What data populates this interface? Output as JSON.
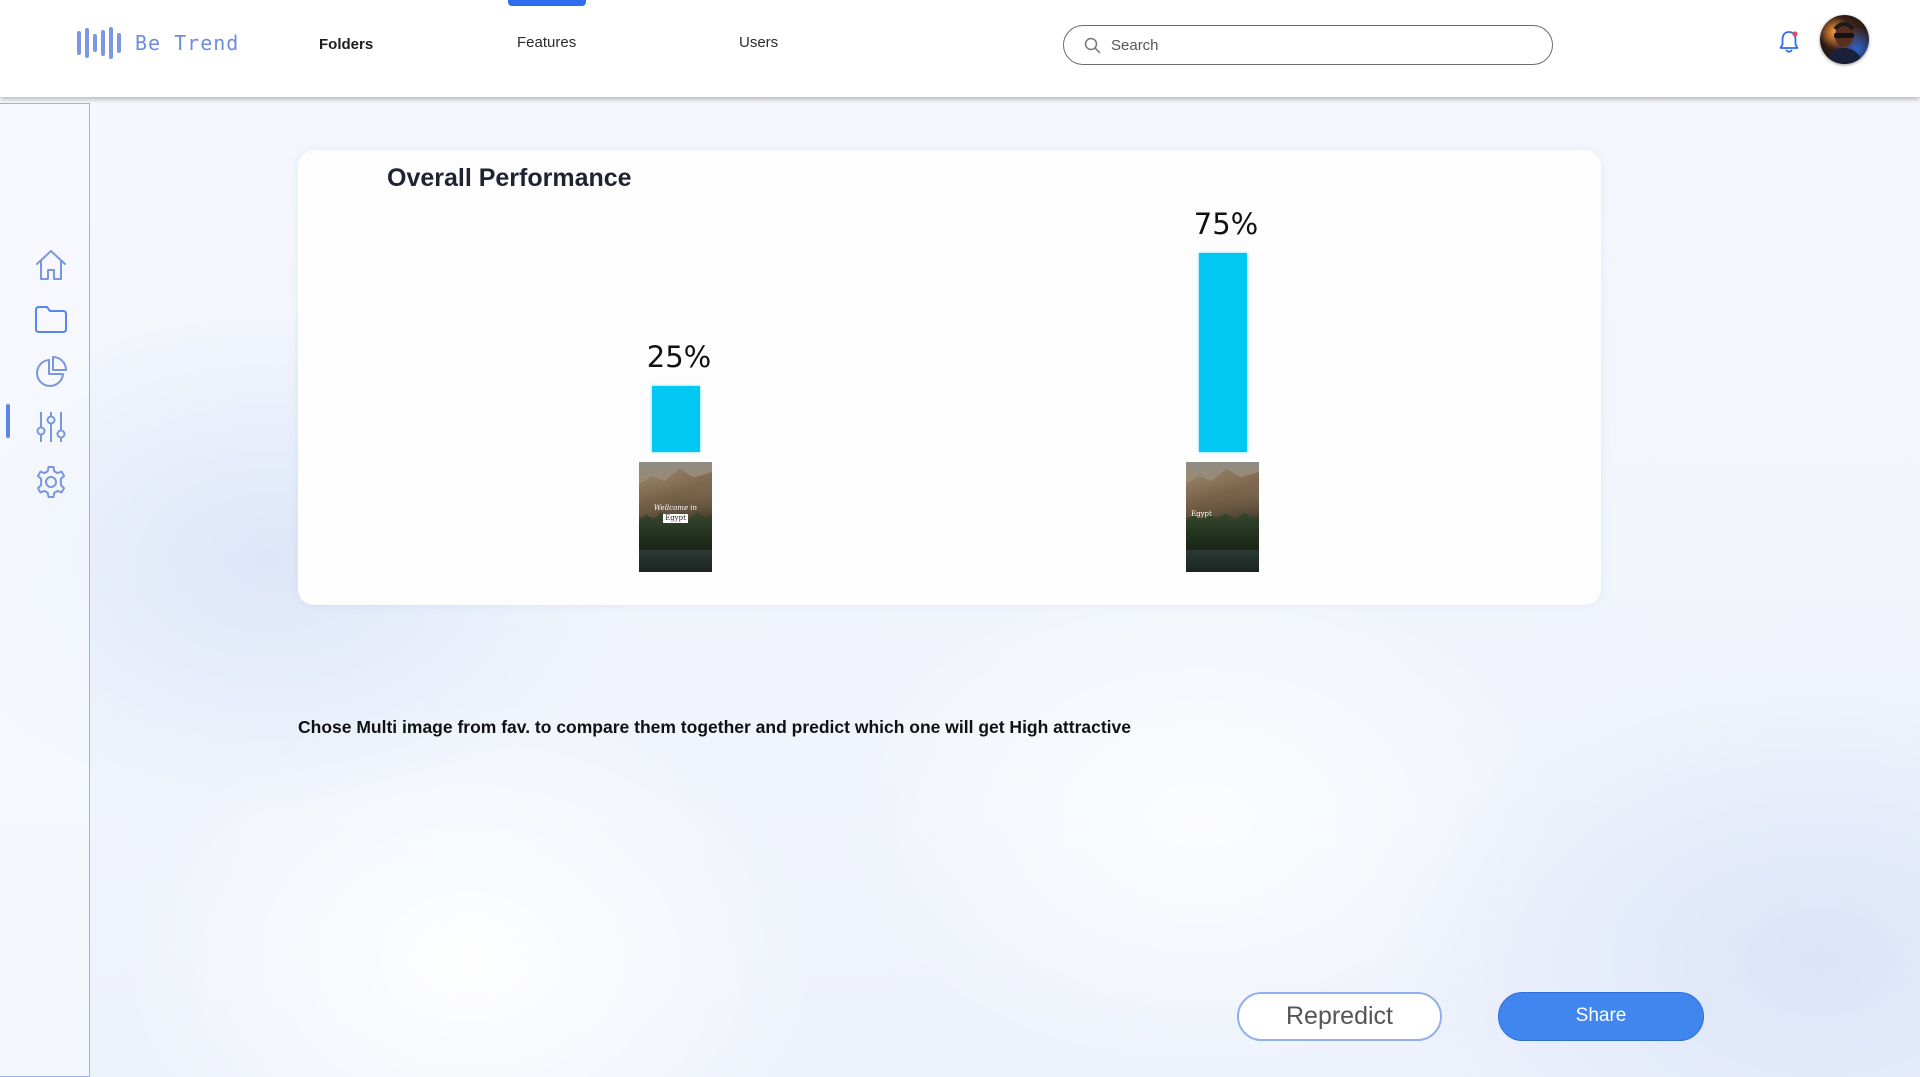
{
  "app": {
    "name": "Be Trend"
  },
  "nav": {
    "items": [
      {
        "label": "Folders",
        "active": true
      },
      {
        "label": "Features",
        "active": false
      },
      {
        "label": "Users",
        "active": false
      }
    ]
  },
  "search": {
    "placeholder": "Search",
    "value": ""
  },
  "header_icons": [
    "bell-icon",
    "avatar"
  ],
  "sidebar": {
    "items": [
      {
        "icon": "home-icon",
        "active": false
      },
      {
        "icon": "folder-icon",
        "active": true
      },
      {
        "icon": "pie-chart-icon",
        "active": false
      },
      {
        "icon": "sliders-icon",
        "active": false
      },
      {
        "icon": "gear-icon",
        "active": false
      }
    ]
  },
  "card": {
    "title": "Overall Performance"
  },
  "chart_data": {
    "type": "bar",
    "title": "Overall Performance",
    "categories": [
      "Wellcome in Egypt",
      "Egypt"
    ],
    "values": [
      25,
      75
    ],
    "value_labels": [
      "25%",
      "75%"
    ],
    "unit": "%",
    "ylim": [
      0,
      100
    ],
    "bar_color": "#00c8f2",
    "grid": false
  },
  "thumbnails": [
    {
      "text_line1": "Wellcome in",
      "text_line2": "Egypt"
    },
    {
      "text_line1": "Egypt"
    }
  ],
  "instruction": "Chose Multi image from fav. to compare them together and predict which one will get High attractive",
  "buttons": {
    "repredict": "Repredict",
    "share": "Share"
  },
  "colors": {
    "accent": "#4186ee",
    "nav_indicator": "#2e6cf0",
    "logo": "#6f8be0"
  }
}
